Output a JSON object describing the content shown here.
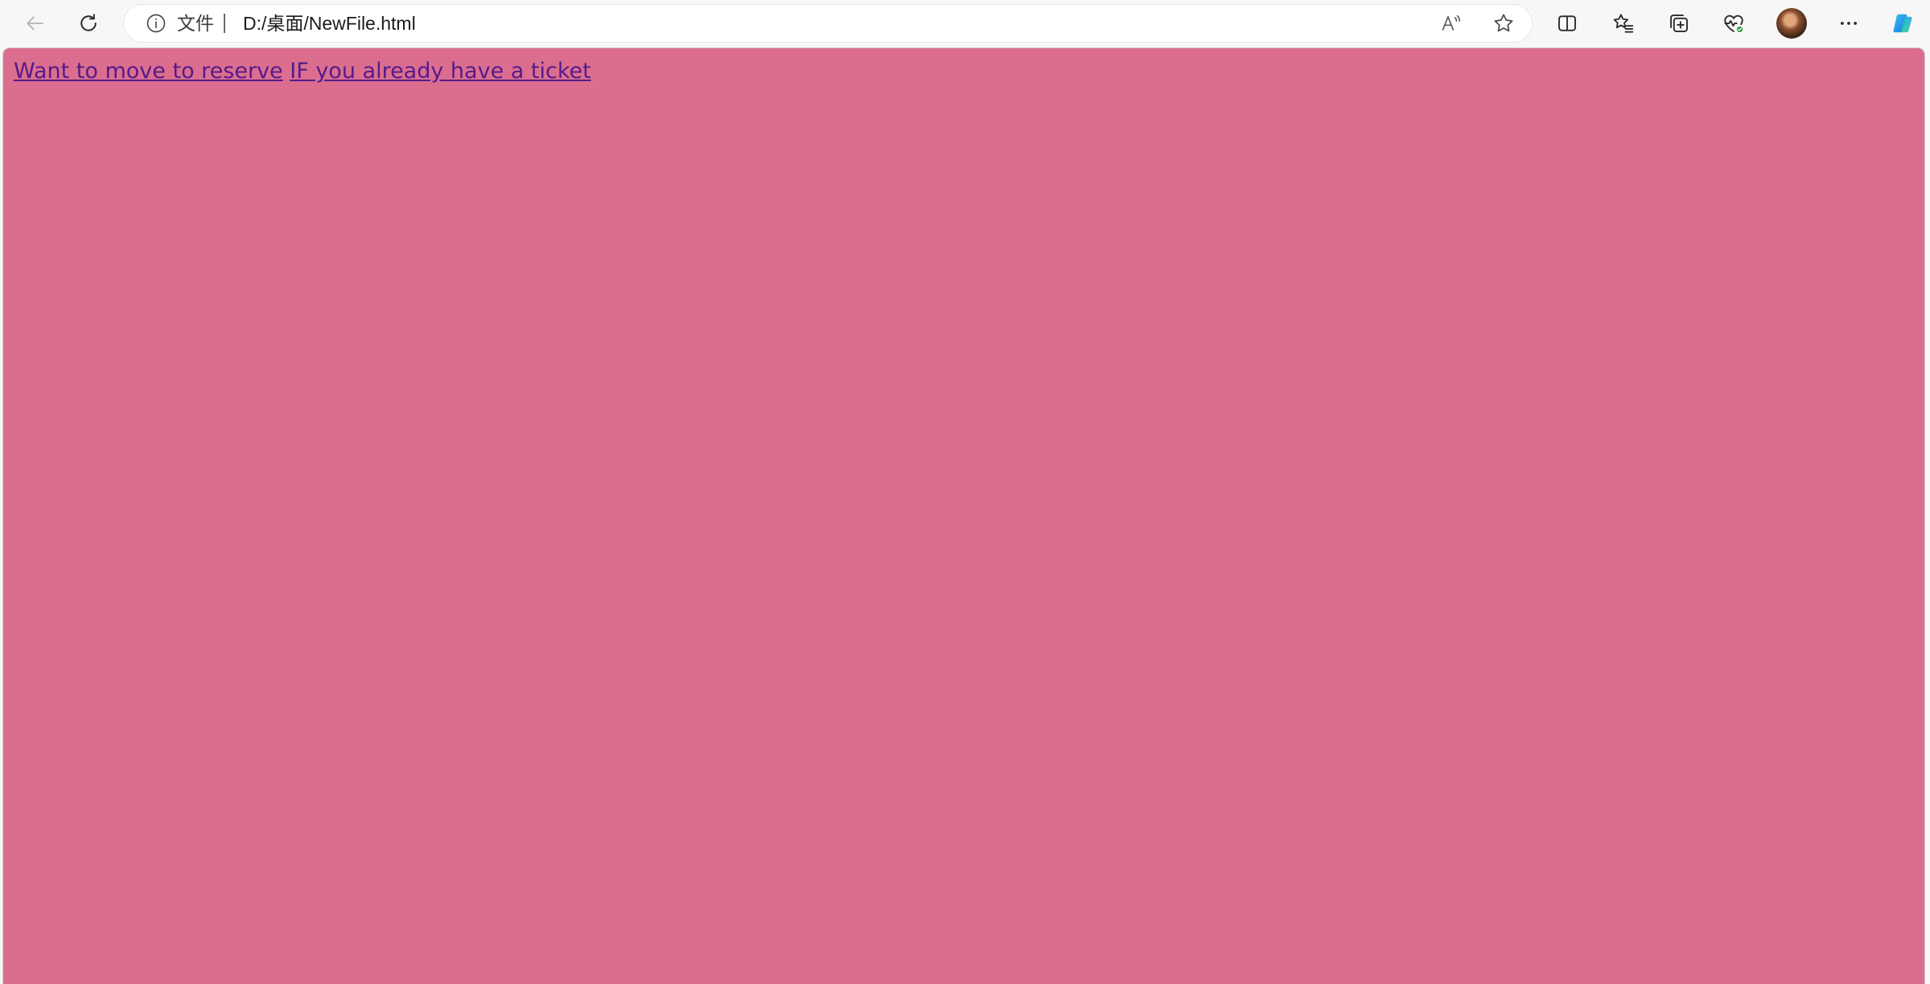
{
  "browser": {
    "address_bar": {
      "scheme_label": "文件",
      "url": "D:/桌面/NewFile.html"
    },
    "icons": {
      "back": "back-arrow-icon",
      "refresh": "refresh-icon",
      "info": "info-icon",
      "read_aloud": "read-aloud-icon",
      "favorite": "star-icon",
      "split_screen": "split-screen-icon",
      "favorites": "favorites-icon",
      "collections": "collections-icon",
      "browser_essentials": "heart-pulse-icon",
      "profile": "avatar",
      "more": "more-icon",
      "copilot": "copilot-icon"
    }
  },
  "page": {
    "background_color": "#db6e8f",
    "link_color": "#551a8b",
    "links": [
      {
        "label": "Want to move to reserve"
      },
      {
        "label": "IF you already have a ticket"
      }
    ]
  }
}
